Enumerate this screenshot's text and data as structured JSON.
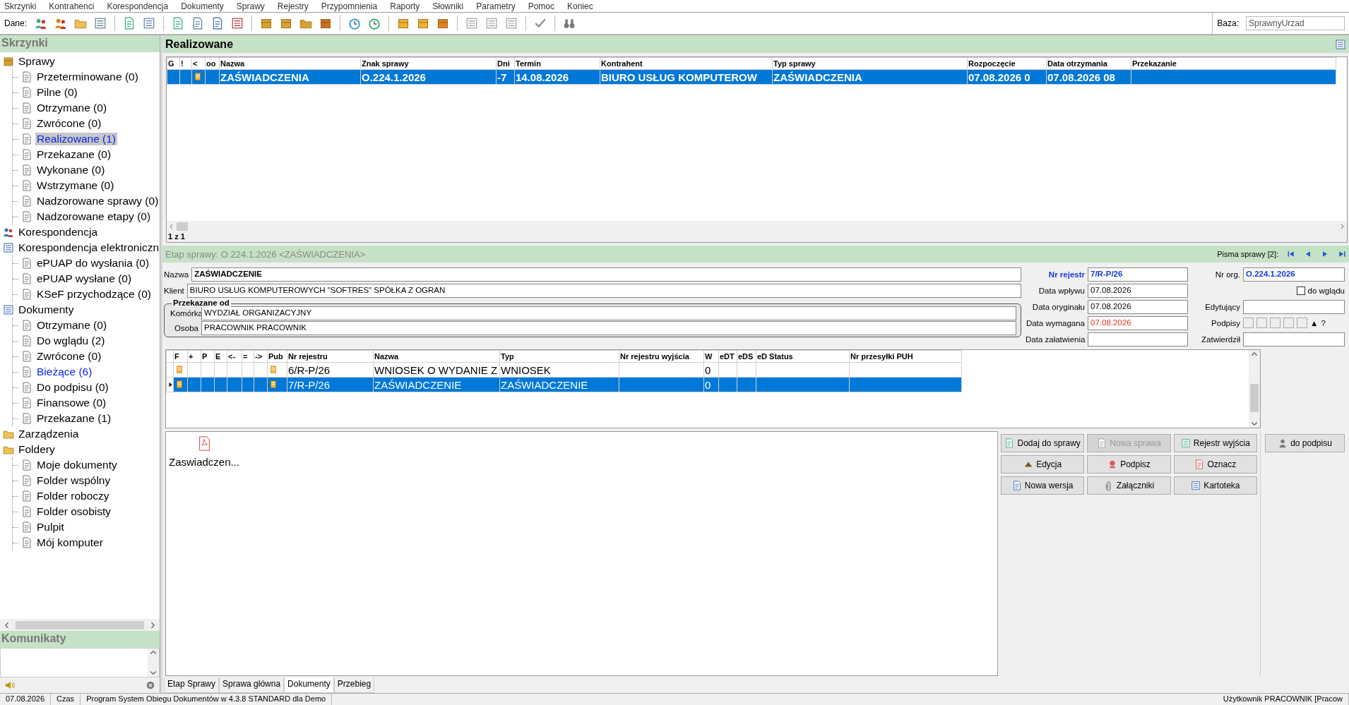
{
  "menu": [
    "Skrzynki",
    "Kontrahenci",
    "Korespondencja",
    "Dokumenty",
    "Sprawy",
    "Rejestry",
    "Przypomnienia",
    "Raporty",
    "Słowniki",
    "Parametry",
    "Pomoc",
    "Koniec"
  ],
  "toolbar": {
    "label": "Dane:",
    "database": {
      "label": "Baza:",
      "value": "SprawnyUrzad"
    }
  },
  "sidebar": {
    "title": "Skrzynki",
    "tree": [
      {
        "label": "Sprawy",
        "selected": false,
        "highlighted": false,
        "children": [
          {
            "label": "Przeterminowane (0)",
            "selected": false,
            "highlighted": false
          },
          {
            "label": "Pilne (0)",
            "selected": false,
            "highlighted": false
          },
          {
            "label": "Otrzymane (0)",
            "selected": false,
            "highlighted": false
          },
          {
            "label": "Zwrócone (0)",
            "selected": false,
            "highlighted": false
          },
          {
            "label": "Realizowane (1)",
            "selected": true,
            "highlighted": true
          },
          {
            "label": "Przekazane (0)",
            "selected": false,
            "highlighted": false
          },
          {
            "label": "Wykonane (0)",
            "selected": false,
            "highlighted": false
          },
          {
            "label": "Wstrzymane (0)",
            "selected": false,
            "highlighted": false
          },
          {
            "label": "Nadzorowane sprawy (0)",
            "selected": false,
            "highlighted": false
          },
          {
            "label": "Nadzorowane etapy (0)",
            "selected": false,
            "highlighted": false
          }
        ]
      },
      {
        "label": "Korespondencja",
        "selected": false,
        "highlighted": false
      },
      {
        "label": "Korespondencja elektroniczn",
        "selected": false,
        "highlighted": false,
        "children": [
          {
            "label": "ePUAP do wysłania (0)",
            "selected": false,
            "highlighted": false
          },
          {
            "label": "ePUAP wysłane (0)",
            "selected": false,
            "highlighted": false
          },
          {
            "label": "KSeF przychodzące (0)",
            "selected": false,
            "highlighted": false
          }
        ]
      },
      {
        "label": "Dokumenty",
        "selected": false,
        "highlighted": false,
        "children": [
          {
            "label": "Otrzymane (0)",
            "selected": false,
            "highlighted": false
          },
          {
            "label": "Do wglądu (2)",
            "selected": false,
            "highlighted": false
          },
          {
            "label": "Zwrócone (0)",
            "selected": false,
            "highlighted": false
          },
          {
            "label": "Bieżące (6)",
            "selected": false,
            "highlighted": true
          },
          {
            "label": "Do podpisu (0)",
            "selected": false,
            "highlighted": false
          },
          {
            "label": "Finansowe (0)",
            "selected": false,
            "highlighted": false
          },
          {
            "label": "Przekazane (1)",
            "selected": false,
            "highlighted": false
          }
        ]
      },
      {
        "label": "Zarządzenia",
        "selected": false,
        "highlighted": false
      },
      {
        "label": "Foldery",
        "selected": false,
        "highlighted": false,
        "children": [
          {
            "label": "Moje dokumenty",
            "selected": false,
            "highlighted": false
          },
          {
            "label": "Folder wspólny",
            "selected": false,
            "highlighted": false
          },
          {
            "label": "Folder roboczy",
            "selected": false,
            "highlighted": false
          },
          {
            "label": "Folder osobisty",
            "selected": false,
            "highlighted": false
          },
          {
            "label": "Pulpit",
            "selected": false,
            "highlighted": false
          },
          {
            "label": "Mój komputer",
            "selected": false,
            "highlighted": false
          }
        ]
      }
    ],
    "messages_title": "Komunikaty"
  },
  "case_list": {
    "title": "Realizowane",
    "columns": [
      "G",
      "!",
      "<",
      "oo",
      "Nazwa",
      "Znak sprawy",
      "Dni",
      "Termin",
      "Kontrahent",
      "Typ sprawy",
      "Rozpoczęcie",
      "Data otrzymania",
      "Przekazanie"
    ],
    "rows": [
      {
        "selected": true,
        "cells": [
          null,
          null,
          {
            "kind": "icon"
          },
          null,
          "ZAŚWIADCZENIA",
          "O.224.1.2026",
          "-7",
          "14.08.2026",
          "BIURO USŁUG KOMPUTEROW",
          "ZAŚWIADCZENIA",
          "07.08.2026 0",
          "07.08.2026 08",
          null
        ]
      }
    ],
    "pager": "1 z 1"
  },
  "stage": {
    "title": "Etap sprawy: O.224.1.2026 <ZAŚWIADCZENIA>",
    "letters_label": "Pisma sprawy [2]:",
    "form": {
      "nazwa": {
        "label": "Nazwa",
        "value": "ZAŚWIADCZENIE"
      },
      "klient": {
        "label": "Klient",
        "value": "BIURO USŁUG KOMPUTEROWYCH \"SOFTRES\" SPÓŁKA Z OGRAN"
      },
      "przekazane_od": {
        "title": "Przekazane od",
        "komorka": {
          "label": "Komórka",
          "value": "WYDZIAŁ ORGANIZACYJNY"
        },
        "osoba": {
          "label": "Osoba",
          "value": "PRACOWNIK PRACOWNIK"
        }
      },
      "nr_rejestr": {
        "label": "Nr rejestr",
        "value": "7/R-P/26"
      },
      "data_wplywu": {
        "label": "Data wpływu",
        "value": "07.08.2026"
      },
      "data_oryginalu": {
        "label": "Data oryginału",
        "value": "07.08.2026"
      },
      "data_wymagana": {
        "label": "Data wymagana",
        "value": "07.08.2026",
        "overdue": true
      },
      "data_zalatwienia": {
        "label": "Data załatwienia"
      },
      "nr_org": {
        "label": "Nr org.",
        "value": "O.224.1.2026"
      },
      "do_wgladu": {
        "label": "do wglądu",
        "checked": false
      },
      "edytujacy": {
        "label": "Edytujący"
      },
      "podpisy": {
        "label": "Podpisy",
        "arrow": "▲",
        "help": "?"
      },
      "zatwierdzil": {
        "label": "Zatwierdził"
      }
    },
    "documents": {
      "columns": [
        "F",
        "+",
        "P",
        "E",
        "<-",
        "=",
        "->",
        "Pub",
        "Nr rejestru",
        "Nazwa",
        "Typ",
        "Nr rejestru wyjścia",
        "W",
        "eDT",
        "eDS",
        "eD Status",
        "Nr przesyłki PUH"
      ],
      "rows": [
        {
          "selected": false,
          "current": false,
          "cells": [
            {
              "kind": "icon"
            },
            null,
            null,
            null,
            null,
            null,
            null,
            {
              "kind": "icon"
            },
            "6/R-P/26",
            "WNIOSEK O WYDANIE Z",
            "WNIOSEK",
            null,
            "0",
            null,
            null,
            null,
            null
          ]
        },
        {
          "selected": true,
          "current": true,
          "cells": [
            {
              "kind": "icon"
            },
            null,
            null,
            null,
            null,
            null,
            null,
            {
              "kind": "icon"
            },
            "7/R-P/26",
            "ZAŚWIADCZENIE",
            "ZAŚWIADCZENIE",
            null,
            "0",
            null,
            null,
            null,
            null
          ]
        }
      ]
    }
  },
  "attachments": [
    {
      "name": "Zaswiadczen..."
    }
  ],
  "buttons": [
    {
      "label": "Dodaj do sprawy",
      "disabled": false
    },
    {
      "label": "Nowa sprawa",
      "disabled": true
    },
    {
      "label": "Rejestr wyjścia",
      "disabled": false
    },
    {
      "label": "Edycja",
      "disabled": false
    },
    {
      "label": "Podpisz",
      "disabled": false
    },
    {
      "label": "Oznacz",
      "disabled": false
    },
    {
      "label": "Nowa wersja",
      "disabled": false
    },
    {
      "label": "Załączniki",
      "disabled": false
    },
    {
      "label": "Kartoteka",
      "disabled": false
    }
  ],
  "side_button": {
    "label": "do podpisu"
  },
  "tabs": [
    {
      "label": "Etap Sprawy",
      "selected": false
    },
    {
      "label": "Sprawa główna",
      "selected": false
    },
    {
      "label": "Dokumenty",
      "selected": true
    },
    {
      "label": "Przebieg",
      "selected": false
    }
  ],
  "status_bar": [
    "07.08.2026",
    "Czas",
    "Program System Obiegu Dokumentów w 4.3.8 STANDARD dla Demo",
    "Użytkownik PRACOWNIK [Pracow"
  ]
}
